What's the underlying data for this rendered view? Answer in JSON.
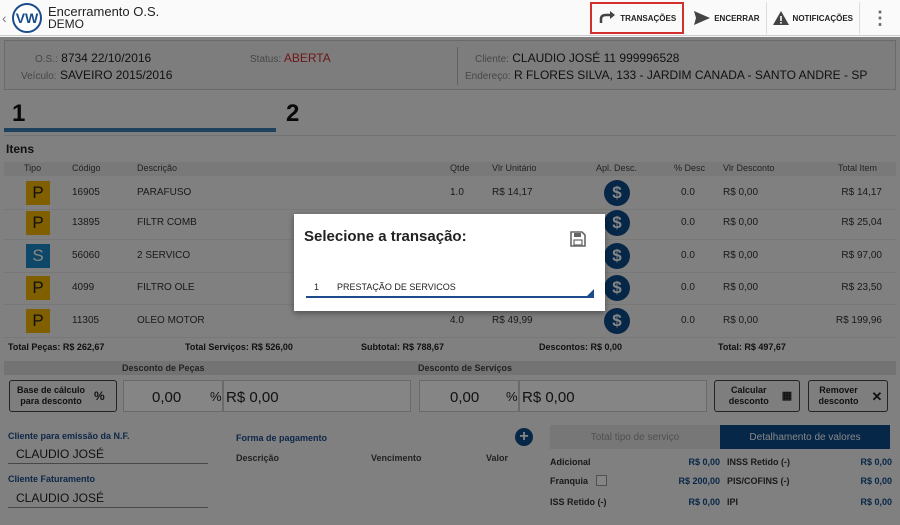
{
  "app": {
    "title": "Encerramento O.S.",
    "subtitle": "DEMO",
    "logo_text": "VW"
  },
  "toolbar": {
    "transacoes": "TRANSAÇÕES",
    "encerrar": "ENCERRAR",
    "notificacoes": "NOTIFICAÇÕES"
  },
  "header": {
    "os_label": "O.S.:",
    "os_value": "8734  22/10/2016",
    "veiculo_label": "Veículo:",
    "veiculo_value": "SAVEIRO  2015/2016",
    "status_label": "Status:",
    "status_value": "ABERTA",
    "cliente_label": "Cliente:",
    "cliente_value": "CLAUDIO JOSÉ 11 999996528",
    "endereco_label": "Endereço:",
    "endereco_value": "R FLORES SILVA, 133 - JARDIM CANADA - SANTO ANDRE - SP"
  },
  "steps": {
    "s1": "1",
    "s2": "2"
  },
  "itens": {
    "label": "Itens",
    "columns": {
      "tipo": "Tipo",
      "codigo": "Código",
      "descricao": "Descrição",
      "qtde": "Qtde",
      "vlr_unitario": "Vlr Unitário",
      "apl_desc": "Apl. Desc.",
      "pct_desc": "% Desc",
      "vlr_desconto": "Vlr Desconto",
      "total_item": "Total Item"
    },
    "rows": [
      {
        "tipo": "P",
        "codigo": "16905",
        "descricao": "PARAFUSO",
        "qtde": "1.0",
        "vlr_unitario": "R$ 14,17",
        "pct_desc": "0.0",
        "vlr_desconto": "R$ 0,00",
        "total_item": "R$ 14,17"
      },
      {
        "tipo": "P",
        "codigo": "13895",
        "descricao": "FILTR COMB",
        "qtde": "",
        "vlr_unitario": "",
        "pct_desc": "0.0",
        "vlr_desconto": "R$ 0,00",
        "total_item": "R$ 25,04"
      },
      {
        "tipo": "S",
        "codigo": "56060",
        "descricao": "2 SERVICO",
        "qtde": "",
        "vlr_unitario": "",
        "pct_desc": "0.0",
        "vlr_desconto": "R$ 0,00",
        "total_item": "R$ 97,00"
      },
      {
        "tipo": "P",
        "codigo": "4099",
        "descricao": "FILTRO OLE",
        "qtde": "",
        "vlr_unitario": "",
        "pct_desc": "0.0",
        "vlr_desconto": "R$ 0,00",
        "total_item": "R$ 23,50"
      },
      {
        "tipo": "P",
        "codigo": "11305",
        "descricao": "OLEO MOTOR",
        "qtde": "4.0",
        "vlr_unitario": "R$ 49,99",
        "pct_desc": "0.0",
        "vlr_desconto": "R$ 0,00",
        "total_item": "R$ 199,96"
      }
    ]
  },
  "totals": {
    "pecas": "Total Peças: R$ 262,67",
    "servicos": "Total Serviços: R$ 526,00",
    "subtotal": "Subtotal: R$ 788,67",
    "descontos": "Descontos: R$ 0,00",
    "total": "Total: R$ 497,67"
  },
  "descontos": {
    "pecas_label": "Desconto de Peças",
    "servicos_label": "Desconto de Serviços",
    "base_btn": "Base de cálculo para desconto",
    "pct_pecas": "0,00",
    "rs_pecas": "R$ 0,00",
    "pct_servicos": "0,00",
    "rs_servicos": "R$ 0,00",
    "pct_sign": "%",
    "calcular_btn": "Calcular desconto",
    "remover_btn": "Remover desconto"
  },
  "nf": {
    "emissao_label": "Cliente para emissão da N.F.",
    "emissao_value": "CLAUDIO JOSÉ",
    "faturamento_label": "Cliente Faturamento",
    "faturamento_value": "CLAUDIO JOSÉ"
  },
  "pagamento": {
    "label": "Forma de pagamento",
    "descricao": "Descrição",
    "vencimento": "Vencimento",
    "valor": "Valor"
  },
  "resumo": {
    "tab_tipo": "Total tipo de serviço",
    "tab_detalhe": "Detalhamento de valores",
    "adicional_label": "Adicional",
    "adicional_value": "R$ 0,00",
    "inss_label": "INSS Retido (-)",
    "inss_value": "R$ 0,00",
    "franquia_label": "Franquia",
    "franquia_value": "R$ 200,00",
    "pis_label": "PIS/COFINS (-)",
    "pis_value": "R$ 0,00",
    "iss_label": "ISS Retido (-)",
    "iss_value": "R$ 0,00",
    "ipi_label": "IPI",
    "ipi_value": "R$ 0,00"
  },
  "dialog": {
    "title": "Selecione a transação:",
    "option_num": "1",
    "option_label": "PRESTAÇÃO DE SERVICOS"
  }
}
